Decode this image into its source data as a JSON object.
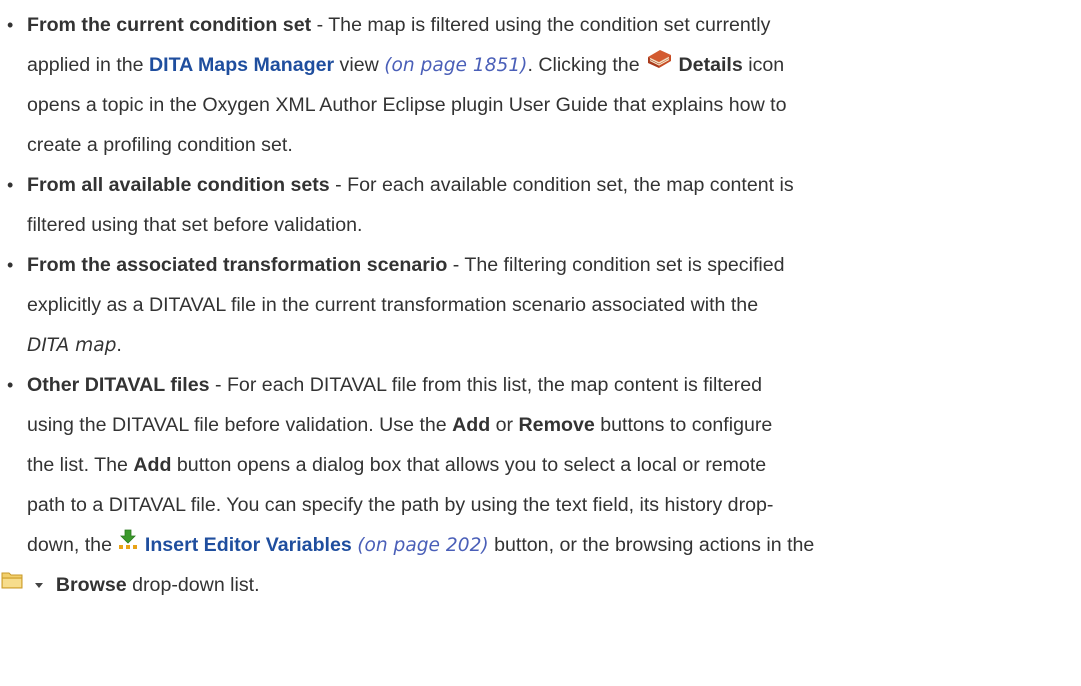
{
  "items": [
    {
      "title": "From the current condition set",
      "l1": " - The map is filtered using the condition set currently",
      "l2_pre": "applied in the ",
      "l2_link": "DITA Maps Manager",
      "l2_mid": " view ",
      "l2_xref": "(on page 1851)",
      "l2_mid2": ". Clicking the ",
      "l2_details": "Details",
      "l2_post": " icon",
      "l3": "opens a topic in the Oxygen XML Author Eclipse plugin User Guide that explains how to",
      "l4": "create a profiling condition set."
    },
    {
      "title": "From all available condition sets",
      "l1": " - For each available condition set, the map content is",
      "l2": "filtered using that set before validation."
    },
    {
      "title": "From the associated transformation scenario",
      "l1": " - The filtering condition set is specified",
      "l2": "explicitly as a DITAVAL file in the current transformation scenario associated with the",
      "l3_term": "DITA map",
      "l3_post": "."
    },
    {
      "title": "Other DITAVAL files",
      "l1": " - For each DITAVAL file from this list, the map content is filtered",
      "l2_pre": "using the DITAVAL file before validation. Use the ",
      "l2_add": "Add",
      "l2_mid": " or ",
      "l2_remove": "Remove",
      "l2_post": " buttons to configure",
      "l3_pre": "the list. The ",
      "l3_add": "Add",
      "l3_post": " button opens a dialog box that allows you to select a local or remote",
      "l4": "path to a DITAVAL file. You can specify the path by using the text field, its history drop-",
      "l5_pre": "down, the ",
      "l5_link": "Insert Editor Variables",
      "l5_xref": "(on page 202)",
      "l5_post": " button, or the browsing actions in the",
      "l6_browse": "Browse",
      "l6_post": " drop-down list."
    }
  ],
  "icons": {
    "details": "book-icon",
    "insert_variables": "insert-variables-icon",
    "browse": "folder-icon",
    "dropdown": "dropdown-arrow-icon"
  }
}
